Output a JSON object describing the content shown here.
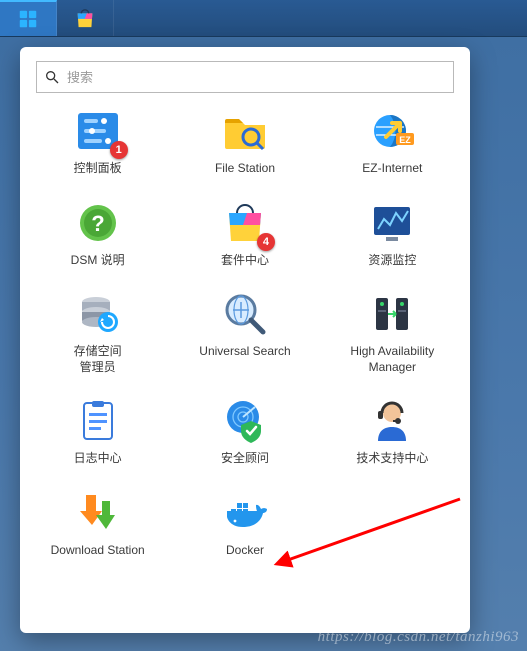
{
  "search": {
    "placeholder": "搜索"
  },
  "apps": [
    {
      "key": "control-panel",
      "label": "控制面板",
      "badge": "1"
    },
    {
      "key": "file-station",
      "label": "File Station",
      "badge": null
    },
    {
      "key": "ez-internet",
      "label": "EZ-Internet",
      "badge": null
    },
    {
      "key": "dsm-help",
      "label": "DSM 说明",
      "badge": null
    },
    {
      "key": "package-center",
      "label": "套件中心",
      "badge": "4"
    },
    {
      "key": "resource-monitor",
      "label": "资源监控",
      "badge": null
    },
    {
      "key": "storage-manager",
      "label": "存储空间\n管理员",
      "badge": null
    },
    {
      "key": "universal-search",
      "label": "Universal Search",
      "badge": null
    },
    {
      "key": "ha-manager",
      "label": "High Availability\nManager",
      "badge": null
    },
    {
      "key": "log-center",
      "label": "日志中心",
      "badge": null
    },
    {
      "key": "security-advisor",
      "label": "安全顾问",
      "badge": null
    },
    {
      "key": "support-center",
      "label": "技术支持中心",
      "badge": null
    },
    {
      "key": "download-station",
      "label": "Download Station",
      "badge": null
    },
    {
      "key": "docker",
      "label": "Docker",
      "badge": null
    }
  ],
  "watermark": "https://blog.csdn.net/tanzhi963"
}
